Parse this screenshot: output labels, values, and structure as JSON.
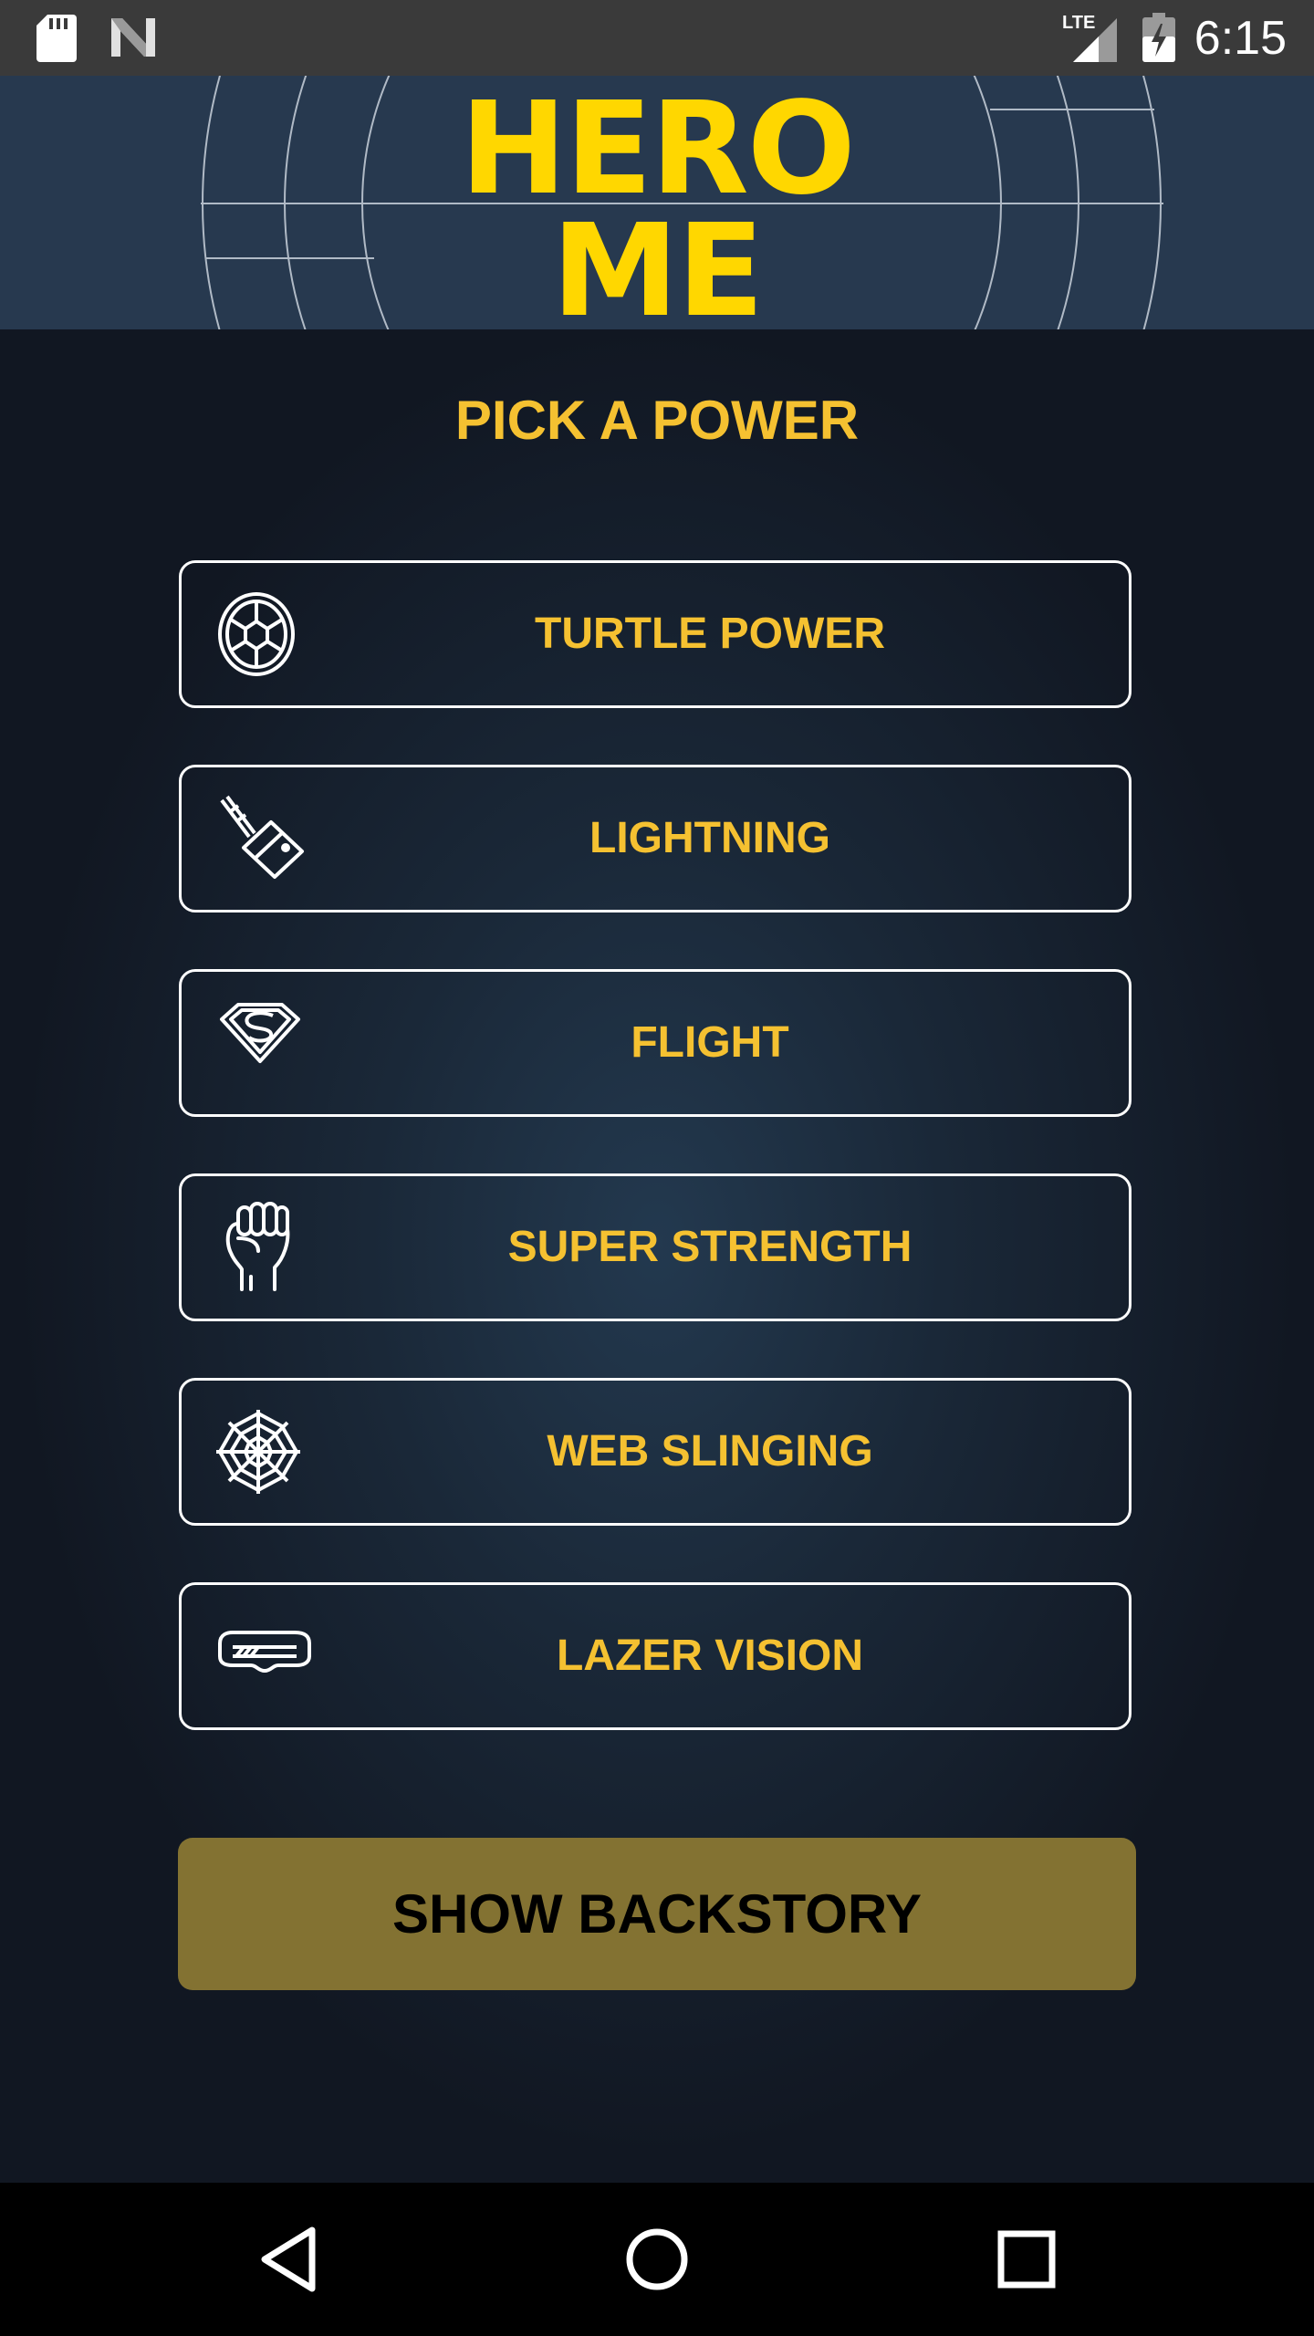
{
  "status_bar": {
    "time": "6:15",
    "network": "LTE",
    "icons": [
      "sd-card-icon",
      "n-icon",
      "signal-icon",
      "battery-icon"
    ]
  },
  "header": {
    "title_line1": "HERO",
    "title_line2": "ME"
  },
  "main": {
    "heading": "PICK A POWER",
    "powers": [
      {
        "label": "TURTLE POWER",
        "icon": "turtle-shell-icon"
      },
      {
        "label": "LIGHTNING",
        "icon": "hammer-icon"
      },
      {
        "label": "FLIGHT",
        "icon": "superman-icon"
      },
      {
        "label": "SUPER STRENGTH",
        "icon": "fist-icon"
      },
      {
        "label": "WEB SLINGING",
        "icon": "spider-web-icon"
      },
      {
        "label": "LAZER VISION",
        "icon": "visor-icon"
      }
    ],
    "backstory_button": "SHOW BACKSTORY"
  },
  "nav_bar": {
    "buttons": [
      "back-icon",
      "home-icon",
      "recents-icon"
    ]
  },
  "colors": {
    "accent": "#f5c131",
    "logo": "#ffd700",
    "header_bg": "#27394f",
    "button_bg": "#837232"
  }
}
